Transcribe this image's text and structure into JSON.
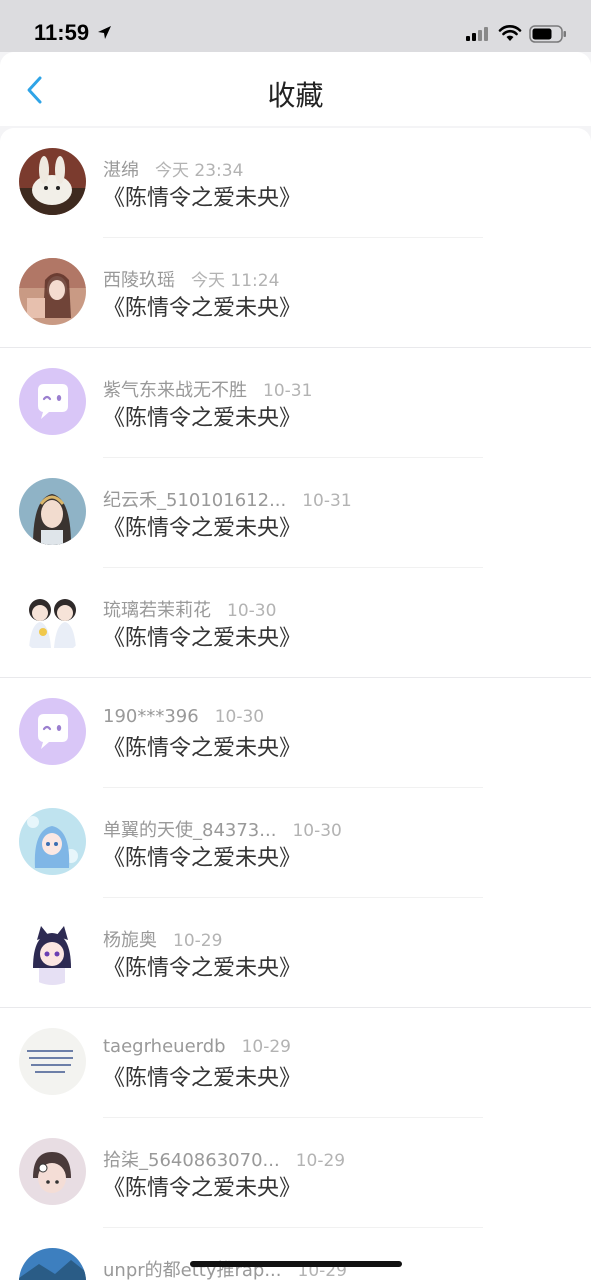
{
  "status_bar": {
    "time": "11:59"
  },
  "nav": {
    "title": "收藏"
  },
  "colors": {
    "accent": "#2fa4e7",
    "name_text": "#999999",
    "title_text": "#333333"
  },
  "favorites": [
    {
      "name": "湛绵",
      "time": "今天 23:34",
      "title": "《陈情令之爱未央》",
      "avatar": "rabbit-avatar"
    },
    {
      "name": "西陵玖瑶",
      "time": "今天 11:24",
      "title": "《陈情令之爱未央》",
      "avatar": "girl-avatar"
    },
    {
      "name": "紫气东来战无不胜",
      "time": "10-31",
      "title": "《陈情令之爱未央》",
      "avatar": "default-chat-avatar"
    },
    {
      "name": "纪云禾_510101612...",
      "time": "10-31",
      "title": "《陈情令之爱未央》",
      "avatar": "portrait-avatar"
    },
    {
      "name": "琉璃若茉莉花",
      "time": "10-30",
      "title": "《陈情令之爱未央》",
      "avatar": "chibi-pair-avatar"
    },
    {
      "name": "190***396",
      "time": "10-30",
      "title": "《陈情令之爱未央》",
      "avatar": "default-chat-avatar"
    },
    {
      "name": "单翼的天使_84373...",
      "time": "10-30",
      "title": "《陈情令之爱未央》",
      "avatar": "anime-girl-avatar"
    },
    {
      "name": "杨旎奥",
      "time": "10-29",
      "title": "《陈情令之爱未央》",
      "avatar": "cat-ear-avatar"
    },
    {
      "name": "taegrheuerdb",
      "time": "10-29",
      "title": "《陈情令之爱未央》",
      "avatar": "text-note-avatar"
    },
    {
      "name": "拾柒_5640863070...",
      "time": "10-29",
      "title": "《陈情令之爱未央》",
      "avatar": "child-avatar"
    },
    {
      "name": "unpr的都etty推rap...",
      "time": "10-29",
      "title": "",
      "avatar": "landscape-avatar"
    }
  ]
}
